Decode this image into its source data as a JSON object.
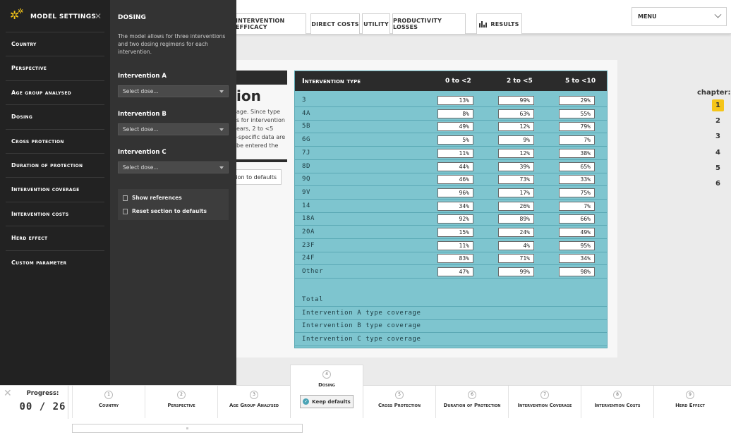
{
  "top_nav": {
    "tabs": [
      {
        "label": "Intervention efficacy"
      },
      {
        "label": "Direct costs"
      },
      {
        "label": "Utility"
      },
      {
        "label": "Productivity losses"
      }
    ],
    "results_label": "Results",
    "menu_label": "Menu"
  },
  "sidebar": {
    "title": "Model settings",
    "items": [
      {
        "label": "Country"
      },
      {
        "label": "Perspective"
      },
      {
        "label": "Age group analysed"
      },
      {
        "label": "Dosing"
      },
      {
        "label": "Cross protection"
      },
      {
        "label": "Duration of protection"
      },
      {
        "label": "Intervention coverage"
      },
      {
        "label": "Intervention costs"
      },
      {
        "label": "Herd effect"
      },
      {
        "label": "Custom parameter"
      }
    ]
  },
  "dosing_panel": {
    "title": "Dosing",
    "description": "The model allows for three interventions and two dosing regimens for each intervention.",
    "interventions": [
      {
        "label": "Intervention A",
        "placeholder": "Select dose..."
      },
      {
        "label": "Intervention B",
        "placeholder": "Select dose..."
      },
      {
        "label": "Intervention C",
        "placeholder": "Select dose..."
      }
    ],
    "show_references": "Show references",
    "reset_section": "Reset section to defaults"
  },
  "main": {
    "heading_fragment": "ion",
    "description_lines": [
      "age. Since type",
      "s for intervention",
      "ears, 2 to <5",
      "-specific data are",
      "be entered the"
    ],
    "reset_label": "ion to defaults"
  },
  "table": {
    "header": {
      "type": "Intervention type",
      "c1": "0 to <2",
      "c2": "2 to <5",
      "c3": "5 to <10"
    },
    "rows": [
      {
        "type": "3",
        "v": [
          "13%",
          "99%",
          "29%"
        ]
      },
      {
        "type": "4A",
        "v": [
          "8%",
          "63%",
          "55%"
        ]
      },
      {
        "type": "5B",
        "v": [
          "49%",
          "12%",
          "79%"
        ]
      },
      {
        "type": "6G",
        "v": [
          "5%",
          "9%",
          "7%"
        ]
      },
      {
        "type": "7J",
        "v": [
          "11%",
          "12%",
          "38%"
        ]
      },
      {
        "type": "8D",
        "v": [
          "44%",
          "39%",
          "65%"
        ]
      },
      {
        "type": "9Q",
        "v": [
          "46%",
          "73%",
          "33%"
        ]
      },
      {
        "type": "9V",
        "v": [
          "96%",
          "17%",
          "75%"
        ]
      },
      {
        "type": "14",
        "v": [
          "34%",
          "26%",
          "7%"
        ]
      },
      {
        "type": "18A",
        "v": [
          "92%",
          "89%",
          "66%"
        ]
      },
      {
        "type": "20A",
        "v": [
          "15%",
          "24%",
          "49%"
        ]
      },
      {
        "type": "23F",
        "v": [
          "11%",
          "4%",
          "95%"
        ]
      },
      {
        "type": "24F",
        "v": [
          "83%",
          "71%",
          "34%"
        ]
      },
      {
        "type": "Other",
        "v": [
          "47%",
          "99%",
          "98%"
        ]
      }
    ],
    "summary": [
      "Total",
      "Intervention A type coverage",
      "Intervention B type coverage",
      "Intervention C type coverage"
    ]
  },
  "chapter": {
    "label": "chapter:",
    "items": [
      "1",
      "2",
      "3",
      "4",
      "5",
      "6"
    ],
    "active": "1"
  },
  "progress": {
    "label": "Progress:",
    "value": "00 / 26"
  },
  "steps": [
    {
      "num": "1",
      "label": "Country"
    },
    {
      "num": "2",
      "label": "Perspective"
    },
    {
      "num": "3",
      "label": "Age Group Analysed"
    },
    {
      "num": "4",
      "label": "Dosing"
    },
    {
      "num": "5",
      "label": "Cross Protection"
    },
    {
      "num": "6",
      "label": "Duration of Protection"
    },
    {
      "num": "7",
      "label": "Intervention Coverage"
    },
    {
      "num": "8",
      "label": "Intervention Costs"
    },
    {
      "num": "9",
      "label": "Herd Effect"
    }
  ],
  "keep_defaults": "Keep defaults",
  "colors": {
    "accent": "#f5c518",
    "table_bg": "#7ec5cf",
    "dark": "#222222"
  }
}
